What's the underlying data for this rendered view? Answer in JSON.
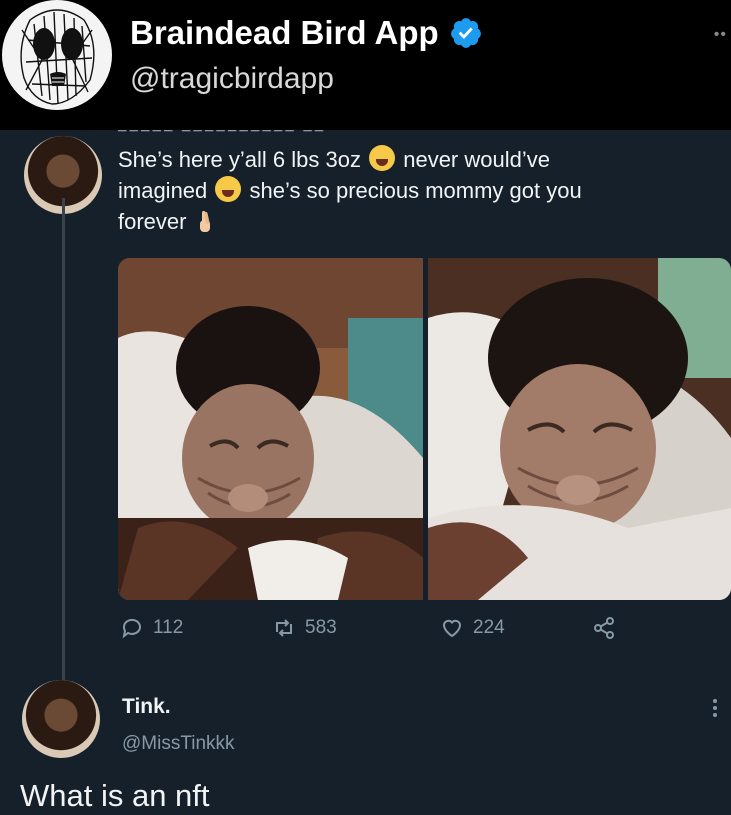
{
  "account": {
    "name": "Braindead Bird App",
    "handle": "@tragicbirdapp",
    "verified": true,
    "verified_color": "#1d9bf0"
  },
  "quoted_tweet": {
    "text_line1_a": "She’s here y’all 6 lbs  3oz",
    "text_line1_b": "never would’ve",
    "text_line2_a": "imagined",
    "text_line2_b": "she’s so precious mommy got you",
    "text_line3": "forever",
    "emojis": [
      "crying-face-emoji",
      "crying-face-emoji",
      "crossed-fingers-emoji"
    ],
    "images": [
      "newborn-photo-1",
      "newborn-photo-2"
    ],
    "stats": {
      "replies": "112",
      "retweets": "583",
      "likes": "224"
    }
  },
  "reply": {
    "name": "Tink.",
    "handle": "@MissTinkkk",
    "text": "What is an nft"
  },
  "colors": {
    "background_top": "#000000",
    "embed_background": "#15202b",
    "muted_text": "#8899a6"
  }
}
